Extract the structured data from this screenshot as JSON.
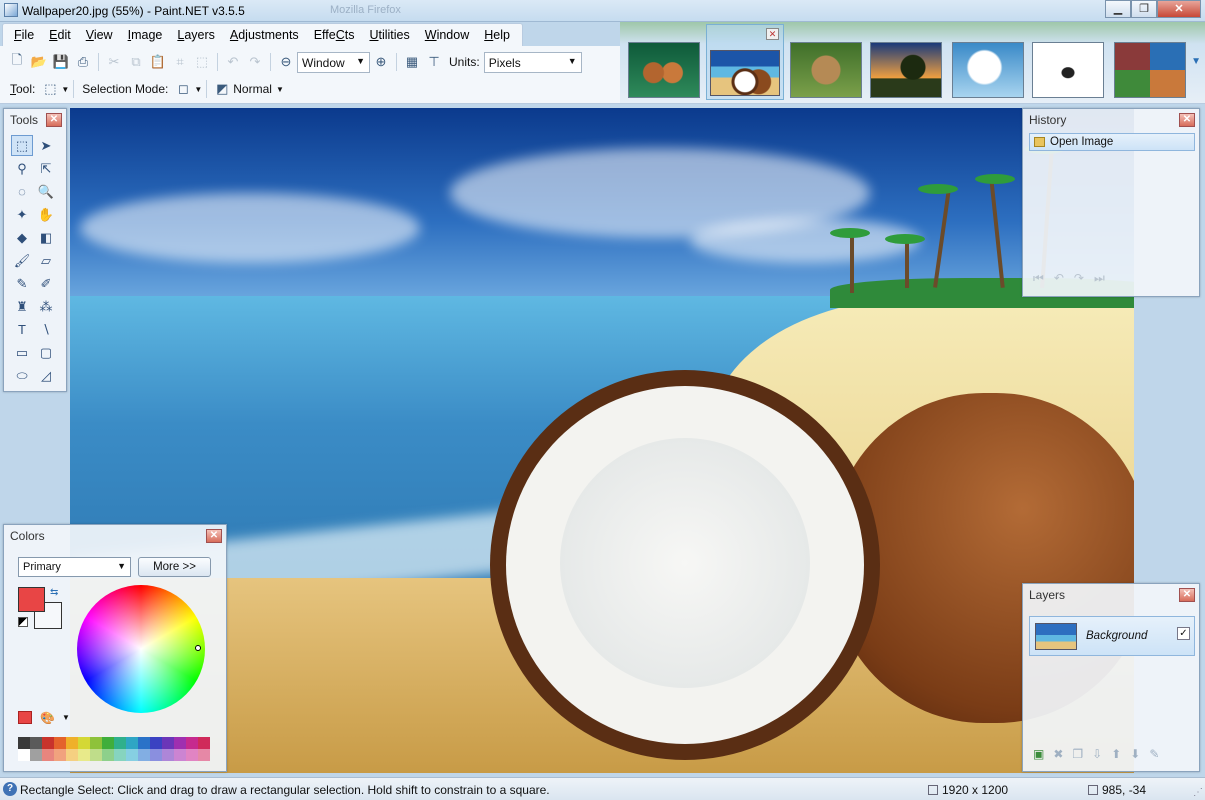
{
  "window": {
    "title": "Wallpaper20.jpg (55%) - Paint.NET v3.5.5",
    "ghost_title": "Mozilla Firefox",
    "minimize": "▁",
    "maximize": "❐",
    "close": "✕"
  },
  "menu": [
    {
      "label": "File",
      "u": "F",
      "rest": "ile"
    },
    {
      "label": "Edit",
      "u": "E",
      "rest": "dit"
    },
    {
      "label": "View",
      "u": "V",
      "rest": "iew"
    },
    {
      "label": "Image",
      "u": "I",
      "rest": "mage"
    },
    {
      "label": "Layers",
      "u": "L",
      "rest": "ayers"
    },
    {
      "label": "Adjustments",
      "u": "A",
      "rest": "djustments"
    },
    {
      "label": "Effects",
      "u": "C",
      "pre": "Effe",
      "rest": "ts"
    },
    {
      "label": "Utilities",
      "u": "U",
      "rest": "tilities"
    },
    {
      "label": "Window",
      "u": "W",
      "rest": "indow"
    },
    {
      "label": "Help",
      "u": "H",
      "rest": "elp"
    }
  ],
  "toolbar": {
    "zoom_value": "Window",
    "units_label": "Units:",
    "units_value": "Pixels",
    "tool_label": "Tool:",
    "selection_mode_label": "Selection Mode:",
    "blend_value": "Normal"
  },
  "image_strip": {
    "selected_index": 1,
    "close_glyph": "✕",
    "overflow_glyph": "▼"
  },
  "tools_panel": {
    "title": "Tools",
    "close": "✕",
    "tools": [
      {
        "name": "rectangle-select-icon",
        "glyph": "⬚",
        "active": true
      },
      {
        "name": "move-selected-pixels-icon",
        "glyph": "➤"
      },
      {
        "name": "lasso-select-icon",
        "glyph": "⚲"
      },
      {
        "name": "move-selection-icon",
        "glyph": "⇱"
      },
      {
        "name": "ellipse-select-icon",
        "glyph": "◌"
      },
      {
        "name": "zoom-icon",
        "glyph": "🔍"
      },
      {
        "name": "magic-wand-icon",
        "glyph": "✦"
      },
      {
        "name": "pan-icon",
        "glyph": "✋"
      },
      {
        "name": "paint-bucket-icon",
        "glyph": "◆"
      },
      {
        "name": "gradient-icon",
        "glyph": "◧"
      },
      {
        "name": "paintbrush-icon",
        "glyph": "🖌"
      },
      {
        "name": "eraser-icon",
        "glyph": "▱"
      },
      {
        "name": "pencil-icon",
        "glyph": "✎"
      },
      {
        "name": "color-picker-icon",
        "glyph": "✐"
      },
      {
        "name": "clone-stamp-icon",
        "glyph": "♜"
      },
      {
        "name": "recolor-icon",
        "glyph": "⁂"
      },
      {
        "name": "text-icon",
        "glyph": "T"
      },
      {
        "name": "line-curve-icon",
        "glyph": "∖"
      },
      {
        "name": "rectangle-icon",
        "glyph": "▭"
      },
      {
        "name": "rounded-rectangle-icon",
        "glyph": "▢"
      },
      {
        "name": "ellipse-icon",
        "glyph": "⬭"
      },
      {
        "name": "freeform-shape-icon",
        "glyph": "◿"
      }
    ]
  },
  "history_panel": {
    "title": "History",
    "close": "✕",
    "items": [
      "Open Image"
    ]
  },
  "layers_panel": {
    "title": "Layers",
    "close": "✕",
    "layers": [
      {
        "name": "Background",
        "visible": true,
        "check": "✓"
      }
    ]
  },
  "colors_panel": {
    "title": "Colors",
    "close": "✕",
    "mode": "Primary",
    "more_button": "More >>",
    "primary_color": "#e84545",
    "secondary_color": "#f6f8fb",
    "palette_row1": [
      "#3a3a3a",
      "#5a5a5a",
      "#c8332c",
      "#e4632c",
      "#efb02a",
      "#d4d835",
      "#8ec23a",
      "#3fae3b",
      "#2fb08c",
      "#2fa6c4",
      "#2a72c8",
      "#3a42c2",
      "#6b36b8",
      "#9f2fb0",
      "#c62a8e",
      "#d02a5a"
    ],
    "palette_row2": [
      "#ffffff",
      "#a0a0a0",
      "#e8857e",
      "#f1a27e",
      "#f5d081",
      "#e8ea8a",
      "#bfdd8a",
      "#8ed08b",
      "#86d4bf",
      "#86cfe2",
      "#82aee3",
      "#8a8fdf",
      "#ad86d8",
      "#cc84d2",
      "#e184c3",
      "#e688a6"
    ]
  },
  "status": {
    "help_text": "Rectangle Select: Click and drag to draw a rectangular selection. Hold shift to constrain to a square.",
    "image_size": "1920 x 1200",
    "cursor_position": "985, -34"
  }
}
